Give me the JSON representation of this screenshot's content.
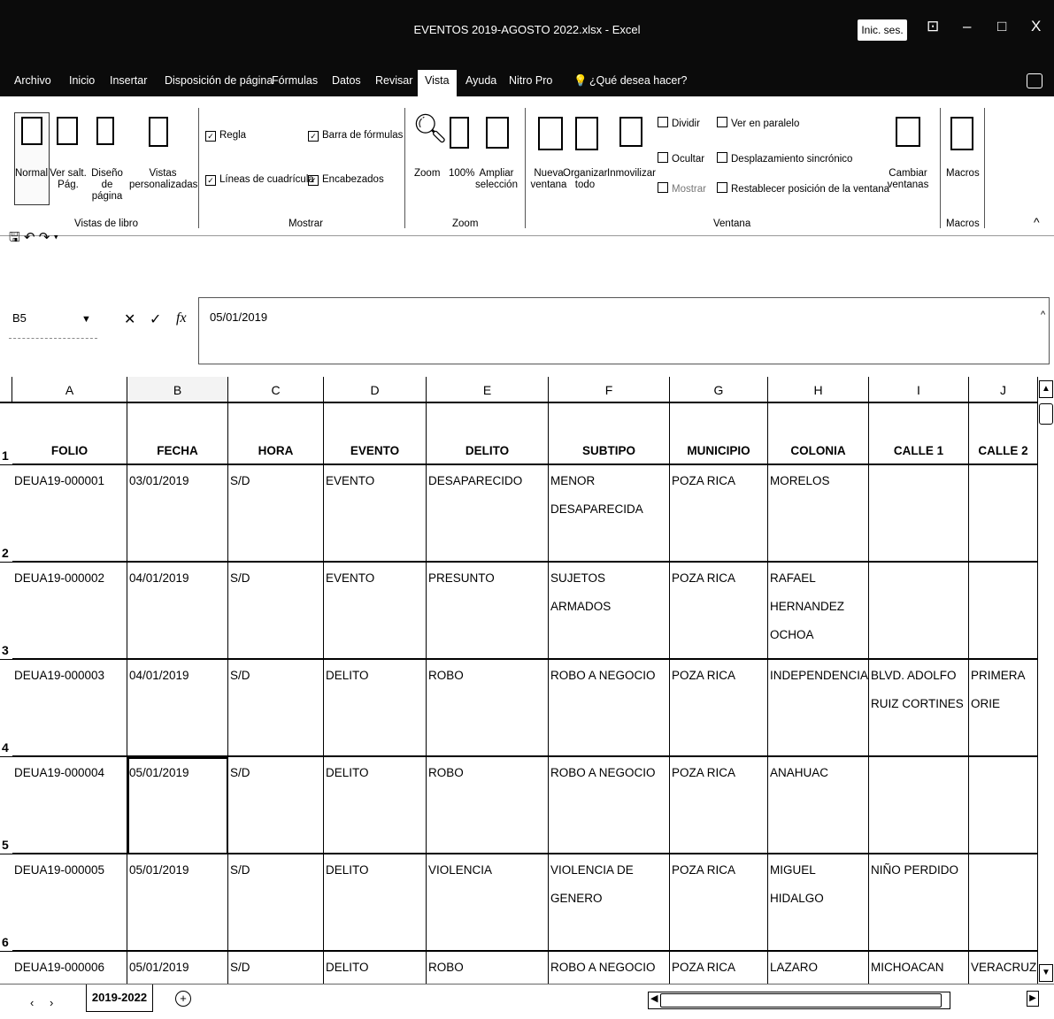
{
  "window": {
    "title": "EVENTOS 2019-AGOSTO 2022.xlsx - Excel",
    "signin_label": "Inic. ses.",
    "minimize": "–",
    "restore": "□",
    "close": "X"
  },
  "menu": {
    "tabs": [
      "Archivo",
      "Inicio",
      "Insertar",
      "Disposición de página",
      "Fórmulas",
      "Datos",
      "Revisar",
      "Vista",
      "Ayuda",
      "Nitro Pro"
    ],
    "active": "Vista",
    "tell_me": "¿Qué desea hacer?"
  },
  "ribbon": {
    "vistas_libro": {
      "label": "Vistas de libro",
      "normal": "Normal",
      "ver_salt": "Ver salt. Pág.",
      "diseno": "Diseño de página",
      "vistas_pers": "Vistas personalizadas"
    },
    "mostrar": {
      "label": "Mostrar",
      "regla": "Regla",
      "lineas": "Líneas de cuadrícula",
      "barra_formulas": "Barra de fórmulas",
      "encabezados": "Encabezados"
    },
    "zoom": {
      "label": "Zoom",
      "zoom": "Zoom",
      "cien": "100%",
      "ampliar": "Ampliar selección"
    },
    "ventana": {
      "label": "Ventana",
      "nueva": "Nueva ventana",
      "organizar": "Organizar todo",
      "inmovilizar": "Inmovilizar",
      "dividir": "Dividir",
      "ocultar": "Ocultar",
      "mostrar": "Mostrar",
      "ver_paralelo": "Ver en paralelo",
      "desplazamiento": "Desplazamiento sincrónico",
      "restablecer": "Restablecer posición de la ventana",
      "cambiar": "Cambiar ventanas"
    },
    "macros": {
      "label": "Macros",
      "macros": "Macros"
    }
  },
  "formula_bar": {
    "name_box": "B5",
    "cancel": "✕",
    "enter": "✓",
    "fx": "fx",
    "value": "05/01/2019"
  },
  "sheet": {
    "columns": [
      "A",
      "B",
      "C",
      "D",
      "E",
      "F",
      "G",
      "H",
      "I",
      "J"
    ],
    "row_numbers": [
      "1",
      "2",
      "3",
      "4",
      "5",
      "6"
    ],
    "headers": [
      "FOLIO",
      "FECHA",
      "HORA",
      "EVENTO",
      "DELITO",
      "SUBTIPO",
      "MUNICIPIO",
      "COLONIA",
      "CALLE 1",
      "CALLE 2"
    ],
    "rows": [
      [
        "DEUA19-000001",
        "03/01/2019",
        "S/D",
        "EVENTO",
        "DESAPARECIDO",
        "MENOR DESAPARECIDA",
        "POZA RICA",
        "MORELOS",
        "",
        ""
      ],
      [
        "DEUA19-000002",
        "04/01/2019",
        "S/D",
        "EVENTO",
        "PRESUNTO",
        "SUJETOS ARMADOS",
        "POZA RICA",
        "RAFAEL HERNANDEZ OCHOA",
        "",
        ""
      ],
      [
        "DEUA19-000003",
        "04/01/2019",
        "S/D",
        "DELITO",
        "ROBO",
        "ROBO A NEGOCIO",
        "POZA RICA",
        "INDEPENDENCIA",
        "BLVD. ADOLFO RUIZ CORTINES",
        "PRIMERA ORIE"
      ],
      [
        "DEUA19-000004",
        "05/01/2019",
        "S/D",
        "DELITO",
        "ROBO",
        "ROBO A NEGOCIO",
        "POZA RICA",
        "ANAHUAC",
        "",
        ""
      ],
      [
        "DEUA19-000005",
        "05/01/2019",
        "S/D",
        "DELITO",
        "VIOLENCIA",
        "VIOLENCIA DE GENERO",
        "POZA RICA",
        "MIGUEL HIDALGO",
        "NIÑO PERDIDO",
        ""
      ],
      [
        "DEUA19-000006",
        "05/01/2019",
        "S/D",
        "DELITO",
        "ROBO",
        "ROBO A NEGOCIO",
        "POZA RICA",
        "LAZARO CARDENAS",
        "MICHOACAN",
        "VERACRUZ"
      ]
    ],
    "tab_name": "2019-2022",
    "add_sheet": "+"
  }
}
